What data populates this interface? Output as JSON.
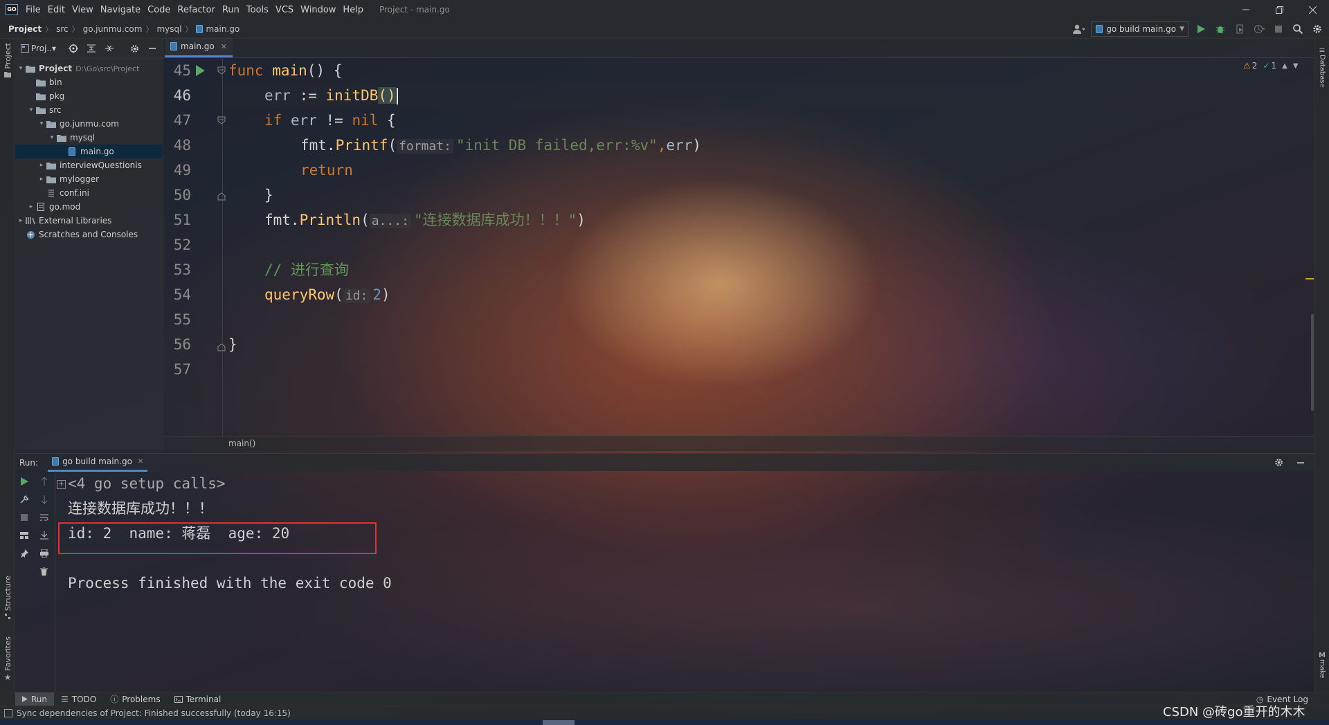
{
  "window": {
    "logo": "GO",
    "menus": [
      "File",
      "Edit",
      "View",
      "Navigate",
      "Code",
      "Refactor",
      "Run",
      "Tools",
      "VCS",
      "Window",
      "Help"
    ],
    "title": "Project - main.go"
  },
  "breadcrumbs": [
    "Project",
    "src",
    "go.junmu.com",
    "mysql",
    "main.go"
  ],
  "run_config": "go build main.go",
  "left_stripe": {
    "project": "Project",
    "structure": "Structure",
    "favorites": "Favorites"
  },
  "right_stripe": {
    "database": "Database",
    "make": "make"
  },
  "project_panel": {
    "selector": "Proj..▾",
    "tree": [
      {
        "label": "Project",
        "hint": "D:\\Go\\src\\Project",
        "depth": 0,
        "arrow": "▾",
        "icon": "folder-icon",
        "bold": true
      },
      {
        "label": "bin",
        "depth": 1,
        "arrow": "",
        "icon": "folder-icon"
      },
      {
        "label": "pkg",
        "depth": 1,
        "arrow": "",
        "icon": "folder-icon"
      },
      {
        "label": "src",
        "depth": 1,
        "arrow": "▾",
        "icon": "folder-icon"
      },
      {
        "label": "go.junmu.com",
        "depth": 2,
        "arrow": "▾",
        "icon": "folder-icon"
      },
      {
        "label": "mysql",
        "depth": 3,
        "arrow": "▾",
        "icon": "folder-icon"
      },
      {
        "label": "main.go",
        "depth": 4,
        "arrow": "",
        "icon": "go-file-icon",
        "selected": true
      },
      {
        "label": "interviewQuestionis",
        "depth": 2,
        "arrow": "▸",
        "icon": "folder-icon"
      },
      {
        "label": "mylogger",
        "depth": 2,
        "arrow": "▸",
        "icon": "folder-icon"
      },
      {
        "label": "conf.ini",
        "depth": 2,
        "arrow": "",
        "icon": "text-file-icon"
      },
      {
        "label": "go.mod",
        "depth": 1,
        "arrow": "▸",
        "icon": "module-file-icon"
      },
      {
        "label": "External Libraries",
        "depth": 0,
        "arrow": "▸",
        "icon": "libraries-icon"
      },
      {
        "label": "Scratches and Consoles",
        "depth": 0,
        "arrow": "",
        "icon": "scratches-icon"
      }
    ]
  },
  "editor": {
    "tab": "main.go",
    "line_numbers": [
      "45",
      "46",
      "47",
      "48",
      "49",
      "50",
      "51",
      "52",
      "53",
      "54",
      "55",
      "56",
      "57"
    ],
    "inspections": {
      "warnings": "2",
      "ok": "1"
    },
    "breadcrumb": "main()",
    "code": {
      "l45": {
        "kw": "func ",
        "fn": "main",
        "rest": "() {"
      },
      "l46": {
        "var": "err",
        "op": " := ",
        "fn": "initDB",
        "paren": "()"
      },
      "l47": {
        "kw": "if ",
        "var": "err",
        "op": " != ",
        "kw2": "nil",
        "rest": " {"
      },
      "l48": {
        "pk": "fmt.",
        "fn": "Printf",
        "open": "(",
        "hint": "format:",
        "str": "\"init DB failed,err:%v\"",
        "comma": ",",
        "var": "err",
        "close": ")"
      },
      "l49": {
        "kw": "return"
      },
      "l50": {
        "rest": "}"
      },
      "l51": {
        "pk": "fmt.",
        "fn": "Println",
        "open": "(",
        "hint": "a...:",
        "str": "\"连接数据库成功！！！\"",
        "close": ")"
      },
      "l53": {
        "cm": "// 进行查询"
      },
      "l54": {
        "fn": "queryRow",
        "open": "(",
        "hint": "id:",
        "num": "2",
        "close": ")"
      },
      "l56": {
        "rest": "}"
      }
    }
  },
  "run_panel": {
    "label": "Run:",
    "tab": "go build main.go",
    "output": [
      "<4 go setup calls>",
      "连接数据库成功！！！",
      "id: 2  name: 蒋磊  age: 20",
      "",
      "Process finished with the exit code 0"
    ]
  },
  "bottom_tabs": [
    "Run",
    "TODO",
    "Problems",
    "Terminal"
  ],
  "event_log": "Event Log",
  "status": "Sync dependencies of Project: Finished successfully (today 16:15)",
  "watermark": "CSDN @砖go重开的木木",
  "colors": {
    "accent": "#4a88c7",
    "keyword": "#cc7832",
    "function": "#ffc66d",
    "string": "#6a8759",
    "highlight_box": "#e03030",
    "run_green": "#59a869"
  }
}
